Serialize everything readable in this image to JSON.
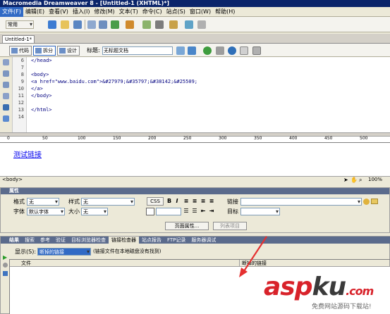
{
  "title": "Macromedia Dreamweaver 8 - [Untitled-1 (XHTML)*]",
  "menu": [
    "文件(F)",
    "编辑(E)",
    "查看(V)",
    "插入(I)",
    "修改(M)",
    "文本(T)",
    "命令(C)",
    "站点(S)",
    "窗口(W)",
    "帮助(H)"
  ],
  "insert_category": "常用",
  "document_tab": "Untitled-1*",
  "view_buttons": {
    "code": "代码",
    "split": "拆分",
    "design": "设计"
  },
  "title_label": "标题:",
  "title_value": "无标题文档",
  "code_lines": [
    {
      "n": "6",
      "text": "</head>"
    },
    {
      "n": "7",
      "text": ""
    },
    {
      "n": "8",
      "text": "<body>"
    },
    {
      "n": "9",
      "text": "<a href=\"www.baidu.com\">&#27979;&#35797;&#38142;&#25509;"
    },
    {
      "n": "10",
      "text": "</a>"
    },
    {
      "n": "11",
      "text": "</body>"
    },
    {
      "n": "12",
      "text": ""
    },
    {
      "n": "13",
      "text": "</html>"
    },
    {
      "n": "14",
      "text": ""
    }
  ],
  "ruler_ticks": [
    "0",
    "50",
    "100",
    "150",
    "200",
    "250",
    "300",
    "350",
    "400",
    "450",
    "500"
  ],
  "design_link": "测试链接",
  "status": {
    "tag": "<body>",
    "zoom": "100%"
  },
  "properties": {
    "header": "属性",
    "format_label": "格式",
    "format_value": "无",
    "style_label": "样式",
    "style_value": "无",
    "css_label": "CSS",
    "link_label": "链接",
    "font_label": "字体",
    "font_value": "默认字体",
    "size_label": "大小",
    "size_value": "无",
    "target_label": "目标",
    "page_props": "页面属性...",
    "list_item": "列表项目"
  },
  "results": {
    "header": "结果",
    "tabs": [
      "搜索",
      "参考",
      "验证",
      "目标浏览器检查",
      "链接检查器",
      "站点报告",
      "FTP记录",
      "服务器调试"
    ],
    "selected_tab": 4,
    "show_label": "显示(S):",
    "show_value": "断掉的链接",
    "note": "(链接文件在本地磁盘没有找到)",
    "col_file": "文件",
    "col_broken": "断掉的链接"
  },
  "watermark": {
    "asp": "asp",
    "ku": "ku",
    ".com": ".com",
    "sub": "免费网站源码下载站!"
  }
}
